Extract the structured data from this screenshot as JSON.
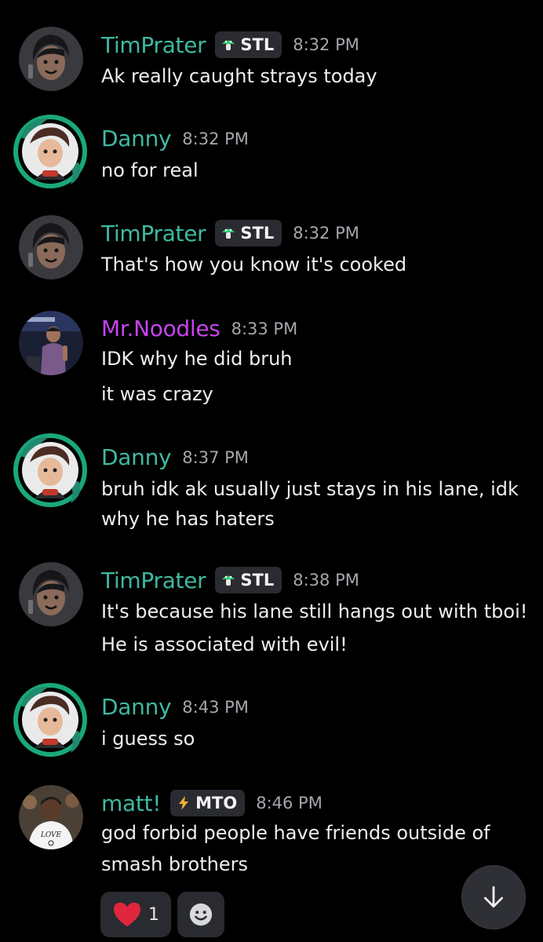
{
  "messages": [
    {
      "author": "TimPrater",
      "author_color": "#3fb9a0",
      "tag": "STL",
      "tag_icon": "mushroom-icon",
      "time": "8:32 PM",
      "lines": [
        "Ak really caught strays today"
      ]
    },
    {
      "author": "Danny",
      "author_color": "#3fb9a0",
      "time": "8:32 PM",
      "lines": [
        "no for real"
      ]
    },
    {
      "author": "TimPrater",
      "author_color": "#3fb9a0",
      "tag": "STL",
      "tag_icon": "mushroom-icon",
      "time": "8:32 PM",
      "lines": [
        "That's how you know it's cooked"
      ]
    },
    {
      "author": "Mr.Noodles",
      "author_color": "#c644f0",
      "time": "8:33 PM",
      "lines": [
        "IDK why he did bruh",
        "it was crazy"
      ]
    },
    {
      "author": "Danny",
      "author_color": "#3fb9a0",
      "time": "8:37 PM",
      "lines": [
        "bruh idk ak usually just stays in his lane, idk",
        "why he has haters"
      ]
    },
    {
      "author": "TimPrater",
      "author_color": "#3fb9a0",
      "tag": "STL",
      "tag_icon": "mushroom-icon",
      "time": "8:38 PM",
      "lines": [
        "It's because his lane still hangs out with tboi!",
        "He is associated with evil!"
      ]
    },
    {
      "author": "Danny",
      "author_color": "#3fb9a0",
      "time": "8:43 PM",
      "lines": [
        "i guess so"
      ]
    },
    {
      "author": "matt!",
      "author_color": "#3fb9a0",
      "tag": "MTO",
      "tag_icon": "lightning-icon",
      "time": "8:46 PM",
      "lines": [
        "god forbid people have friends outside of",
        "smash brothers"
      ]
    }
  ],
  "reactions": [
    {
      "icon": "heart-icon",
      "count": "1"
    },
    {
      "icon": "add-reaction-icon"
    }
  ],
  "controls": {
    "scroll_to_bottom_icon": "arrow-down-icon"
  },
  "colors": {
    "background": "#000000",
    "accent": "#3fb9a0",
    "tag_bg": "#2a2b30",
    "mushroom": "#2ecc71",
    "lightning": "#f0b232",
    "heart": "#e0263c"
  }
}
